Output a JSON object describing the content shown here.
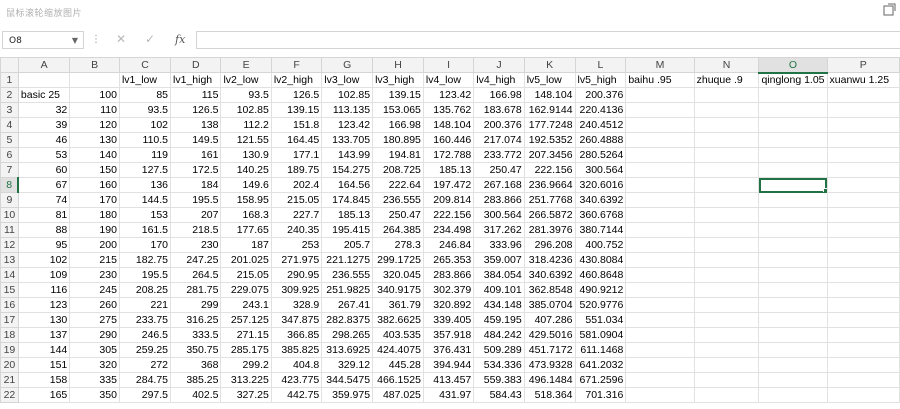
{
  "window": {
    "title": "鼠标滚轮缩放图片"
  },
  "formula_bar": {
    "name_box": "O8",
    "formula": "",
    "fx_label": "fx"
  },
  "columns": [
    "A",
    "B",
    "C",
    "D",
    "E",
    "F",
    "G",
    "H",
    "I",
    "J",
    "K",
    "L",
    "M",
    "N",
    "O",
    "P"
  ],
  "selected_cell": {
    "col": "O",
    "row": "8"
  },
  "rows": [
    {
      "n": "1",
      "cells": [
        "",
        "",
        "lv1_low",
        "lv1_high",
        "lv2_low",
        "lv2_high",
        "lv3_low",
        "lv3_high",
        "lv4_low",
        "lv4_high",
        "lv5_low",
        "lv5_high",
        "baihu .95",
        "zhuque .9",
        "qinglong 1.05",
        "xuanwu 1.25"
      ]
    },
    {
      "n": "2",
      "cells": [
        "basic 25",
        "100",
        "85",
        "115",
        "93.5",
        "126.5",
        "102.85",
        "139.15",
        "123.42",
        "166.98",
        "148.104",
        "200.376",
        "",
        "",
        "",
        ""
      ]
    },
    {
      "n": "3",
      "cells": [
        "32",
        "110",
        "93.5",
        "126.5",
        "102.85",
        "139.15",
        "113.135",
        "153.065",
        "135.762",
        "183.678",
        "162.9144",
        "220.4136",
        "",
        "",
        "",
        ""
      ]
    },
    {
      "n": "4",
      "cells": [
        "39",
        "120",
        "102",
        "138",
        "112.2",
        "151.8",
        "123.42",
        "166.98",
        "148.104",
        "200.376",
        "177.7248",
        "240.4512",
        "",
        "",
        "",
        ""
      ]
    },
    {
      "n": "5",
      "cells": [
        "46",
        "130",
        "110.5",
        "149.5",
        "121.55",
        "164.45",
        "133.705",
        "180.895",
        "160.446",
        "217.074",
        "192.5352",
        "260.4888",
        "",
        "",
        "",
        ""
      ]
    },
    {
      "n": "6",
      "cells": [
        "53",
        "140",
        "119",
        "161",
        "130.9",
        "177.1",
        "143.99",
        "194.81",
        "172.788",
        "233.772",
        "207.3456",
        "280.5264",
        "",
        "",
        "",
        ""
      ]
    },
    {
      "n": "7",
      "cells": [
        "60",
        "150",
        "127.5",
        "172.5",
        "140.25",
        "189.75",
        "154.275",
        "208.725",
        "185.13",
        "250.47",
        "222.156",
        "300.564",
        "",
        "",
        "",
        ""
      ]
    },
    {
      "n": "8",
      "cells": [
        "67",
        "160",
        "136",
        "184",
        "149.6",
        "202.4",
        "164.56",
        "222.64",
        "197.472",
        "267.168",
        "236.9664",
        "320.6016",
        "",
        "",
        "",
        ""
      ]
    },
    {
      "n": "9",
      "cells": [
        "74",
        "170",
        "144.5",
        "195.5",
        "158.95",
        "215.05",
        "174.845",
        "236.555",
        "209.814",
        "283.866",
        "251.7768",
        "340.6392",
        "",
        "",
        "",
        ""
      ]
    },
    {
      "n": "10",
      "cells": [
        "81",
        "180",
        "153",
        "207",
        "168.3",
        "227.7",
        "185.13",
        "250.47",
        "222.156",
        "300.564",
        "266.5872",
        "360.6768",
        "",
        "",
        "",
        ""
      ]
    },
    {
      "n": "11",
      "cells": [
        "88",
        "190",
        "161.5",
        "218.5",
        "177.65",
        "240.35",
        "195.415",
        "264.385",
        "234.498",
        "317.262",
        "281.3976",
        "380.7144",
        "",
        "",
        "",
        ""
      ]
    },
    {
      "n": "12",
      "cells": [
        "95",
        "200",
        "170",
        "230",
        "187",
        "253",
        "205.7",
        "278.3",
        "246.84",
        "333.96",
        "296.208",
        "400.752",
        "",
        "",
        "",
        ""
      ]
    },
    {
      "n": "13",
      "cells": [
        "102",
        "215",
        "182.75",
        "247.25",
        "201.025",
        "271.975",
        "221.1275",
        "299.1725",
        "265.353",
        "359.007",
        "318.4236",
        "430.8084",
        "",
        "",
        "",
        ""
      ]
    },
    {
      "n": "14",
      "cells": [
        "109",
        "230",
        "195.5",
        "264.5",
        "215.05",
        "290.95",
        "236.555",
        "320.045",
        "283.866",
        "384.054",
        "340.6392",
        "460.8648",
        "",
        "",
        "",
        ""
      ]
    },
    {
      "n": "15",
      "cells": [
        "116",
        "245",
        "208.25",
        "281.75",
        "229.075",
        "309.925",
        "251.9825",
        "340.9175",
        "302.379",
        "409.101",
        "362.8548",
        "490.9212",
        "",
        "",
        "",
        ""
      ]
    },
    {
      "n": "16",
      "cells": [
        "123",
        "260",
        "221",
        "299",
        "243.1",
        "328.9",
        "267.41",
        "361.79",
        "320.892",
        "434.148",
        "385.0704",
        "520.9776",
        "",
        "",
        "",
        ""
      ]
    },
    {
      "n": "17",
      "cells": [
        "130",
        "275",
        "233.75",
        "316.25",
        "257.125",
        "347.875",
        "282.8375",
        "382.6625",
        "339.405",
        "459.195",
        "407.286",
        "551.034",
        "",
        "",
        "",
        ""
      ]
    },
    {
      "n": "18",
      "cells": [
        "137",
        "290",
        "246.5",
        "333.5",
        "271.15",
        "366.85",
        "298.265",
        "403.535",
        "357.918",
        "484.242",
        "429.5016",
        "581.0904",
        "",
        "",
        "",
        ""
      ]
    },
    {
      "n": "19",
      "cells": [
        "144",
        "305",
        "259.25",
        "350.75",
        "285.175",
        "385.825",
        "313.6925",
        "424.4075",
        "376.431",
        "509.289",
        "451.7172",
        "611.1468",
        "",
        "",
        "",
        ""
      ]
    },
    {
      "n": "20",
      "cells": [
        "151",
        "320",
        "272",
        "368",
        "299.2",
        "404.8",
        "329.12",
        "445.28",
        "394.944",
        "534.336",
        "473.9328",
        "641.2032",
        "",
        "",
        "",
        ""
      ]
    },
    {
      "n": "21",
      "cells": [
        "158",
        "335",
        "284.75",
        "385.25",
        "313.225",
        "423.775",
        "344.5475",
        "466.1525",
        "413.457",
        "559.383",
        "496.1484",
        "671.2596",
        "",
        "",
        "",
        ""
      ]
    },
    {
      "n": "22",
      "cells": [
        "165",
        "350",
        "297.5",
        "402.5",
        "327.25",
        "442.75",
        "359.975",
        "487.025",
        "431.97",
        "584.43",
        "518.364",
        "701.316",
        "",
        "",
        "",
        ""
      ]
    }
  ]
}
